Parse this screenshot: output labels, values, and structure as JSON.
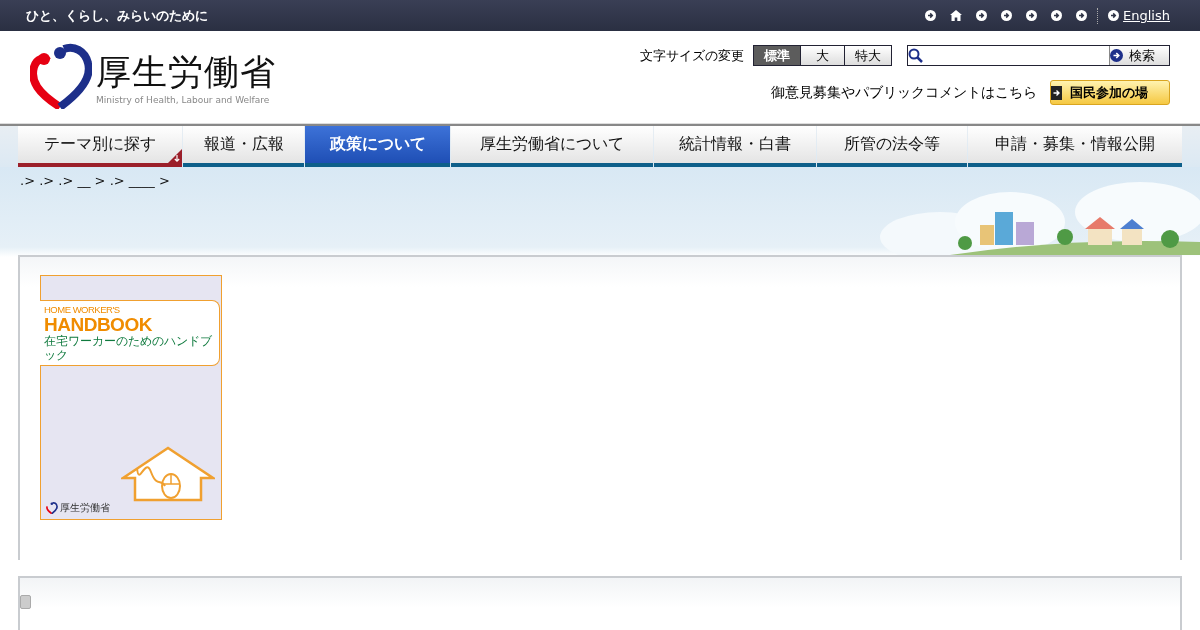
{
  "top_bar": {
    "tagline": "ひと、くらし、みらいのために",
    "nav_icons": [
      {
        "kind": "arrow"
      },
      {
        "kind": "home"
      },
      {
        "kind": "arrow"
      },
      {
        "kind": "arrow"
      },
      {
        "kind": "arrow"
      },
      {
        "kind": "arrow"
      },
      {
        "kind": "arrow"
      }
    ],
    "english_link": "English"
  },
  "header": {
    "logo_title": "厚生労働省",
    "logo_subtitle": "Ministry of Health, Labour and Welfare",
    "font_size": {
      "label": "文字サイズの変更",
      "options": [
        {
          "label": "標準",
          "selected": true
        },
        {
          "label": "大",
          "selected": false
        },
        {
          "label": "特大",
          "selected": false
        }
      ]
    },
    "search": {
      "button": "検索"
    },
    "participation": {
      "text": "御意見募集やパブリックコメントはこちら",
      "button": "国民参加の場"
    }
  },
  "nav": [
    {
      "label": "テーマ別に探す",
      "kind": "theme",
      "selected": false
    },
    {
      "label": "報道・広報",
      "kind": "menu",
      "selected": false
    },
    {
      "label": "政策について",
      "kind": "menu",
      "selected": true
    },
    {
      "label": "厚生労働省について",
      "kind": "menu",
      "selected": false
    },
    {
      "label": "統計情報・白書",
      "kind": "menu",
      "selected": false
    },
    {
      "label": "所管の法令等",
      "kind": "menu",
      "selected": false
    },
    {
      "label": "申請・募集・情報公開",
      "kind": "menu",
      "selected": false
    }
  ],
  "breadcrumb": ".> .> .> __ > .> ____ >",
  "document": {
    "subtitle_en": "HOME WORKER'S",
    "title": "HANDBOOK",
    "subtitle_ja": "在宅ワーカーのためのハンドブック",
    "publisher": "厚生労働省"
  }
}
